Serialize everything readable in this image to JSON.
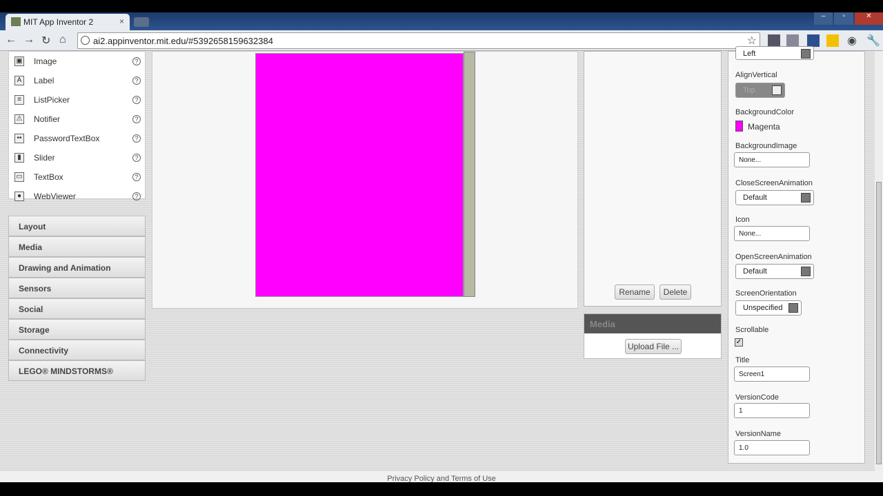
{
  "browser": {
    "tab_title": "MIT App Inventor 2",
    "url": "ai2.appinventor.mit.edu/#5392658159632384"
  },
  "palette": {
    "items": [
      {
        "label": "Image",
        "icon": "image-icon",
        "glyph": "▣"
      },
      {
        "label": "Label",
        "icon": "label-icon",
        "glyph": "A"
      },
      {
        "label": "ListPicker",
        "icon": "listpicker-icon",
        "glyph": "≡"
      },
      {
        "label": "Notifier",
        "icon": "notifier-icon",
        "glyph": "⚠"
      },
      {
        "label": "PasswordTextBox",
        "icon": "password-icon",
        "glyph": "••"
      },
      {
        "label": "Slider",
        "icon": "slider-icon",
        "glyph": "▮"
      },
      {
        "label": "TextBox",
        "icon": "textbox-icon",
        "glyph": "▭"
      },
      {
        "label": "WebViewer",
        "icon": "webviewer-icon",
        "glyph": "●"
      }
    ],
    "help_glyph": "?",
    "categories": [
      "Layout",
      "Media",
      "Drawing and Animation",
      "Sensors",
      "Social",
      "Storage",
      "Connectivity",
      "LEGO® MINDSTORMS®"
    ]
  },
  "viewer": {
    "screen_color": "#ff00ff"
  },
  "components": {
    "rename_label": "Rename",
    "delete_label": "Delete"
  },
  "media": {
    "title": "Media",
    "upload_label": "Upload File ..."
  },
  "properties": {
    "align_horizontal_value": "Left",
    "align_vertical": {
      "label": "AlignVertical",
      "value": "Top"
    },
    "background_color": {
      "label": "BackgroundColor",
      "value": "Magenta",
      "swatch": "#ff00ff"
    },
    "background_image": {
      "label": "BackgroundImage",
      "value": "None..."
    },
    "close_screen_animation": {
      "label": "CloseScreenAnimation",
      "value": "Default"
    },
    "icon": {
      "label": "Icon",
      "value": "None..."
    },
    "open_screen_animation": {
      "label": "OpenScreenAnimation",
      "value": "Default"
    },
    "screen_orientation": {
      "label": "ScreenOrientation",
      "value": "Unspecified"
    },
    "scrollable": {
      "label": "Scrollable",
      "checked": true,
      "glyph": "✓"
    },
    "title": {
      "label": "Title",
      "value": "Screen1"
    },
    "version_code": {
      "label": "VersionCode",
      "value": "1"
    },
    "version_name": {
      "label": "VersionName",
      "value": "1.0"
    }
  },
  "footer": {
    "text": "Privacy Policy and Terms of Use"
  }
}
